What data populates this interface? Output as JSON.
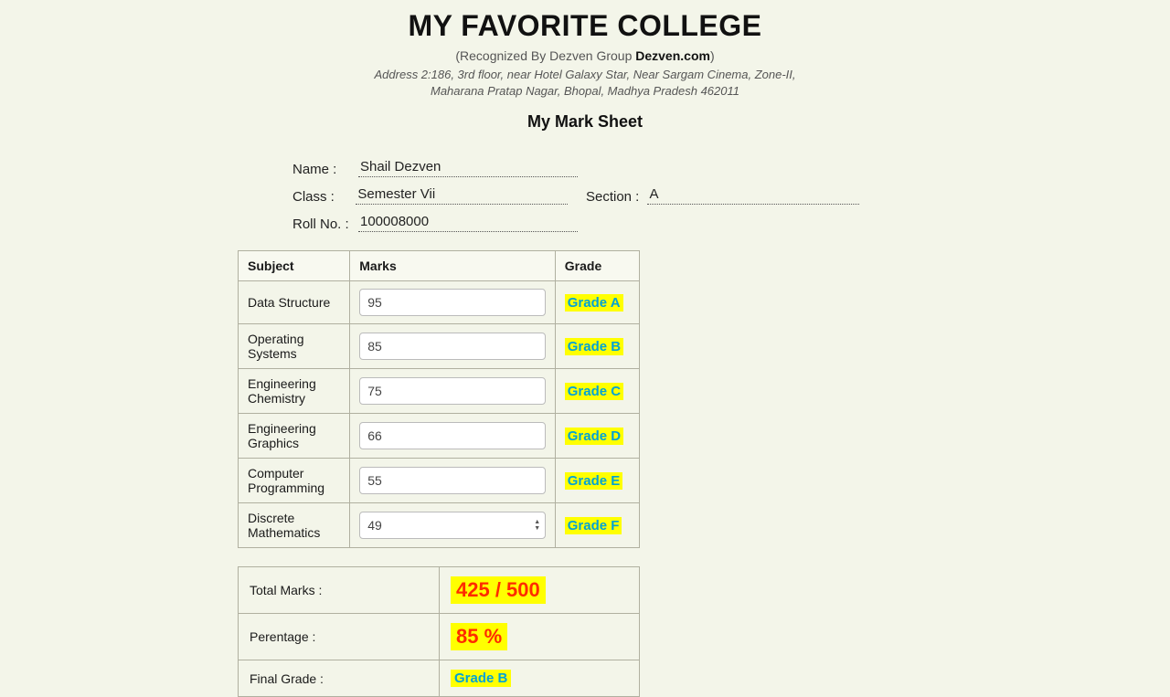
{
  "header": {
    "title": "MY FAVORITE COLLEGE",
    "recognized_pre": "(Recognized By Dezven Group ",
    "recognized_bold": "Dezven.com",
    "recognized_post": ")",
    "address_line1": "Address 2:186, 3rd floor, near Hotel Galaxy Star, Near Sargam Cinema, Zone-II,",
    "address_line2": "Maharana Pratap Nagar, Bhopal, Madhya Pradesh 462011",
    "subtitle": "My Mark Sheet"
  },
  "info": {
    "name_label": "Name :",
    "name_value": "Shail Dezven",
    "class_label": "Class :",
    "class_value": "Semester Vii",
    "section_label": "Section :",
    "section_value": "A",
    "roll_label": "Roll No. :",
    "roll_value": "100008000"
  },
  "table": {
    "headers": {
      "subject": "Subject",
      "marks": "Marks",
      "grade": "Grade"
    },
    "rows": [
      {
        "subject": "Data Structure",
        "marks": "95",
        "grade": "Grade A"
      },
      {
        "subject": "Operating Systems",
        "marks": "85",
        "grade": "Grade B"
      },
      {
        "subject": "Engineering Chemistry",
        "marks": "75",
        "grade": "Grade C"
      },
      {
        "subject": "Engineering Graphics",
        "marks": "66",
        "grade": "Grade D"
      },
      {
        "subject": "Computer Programming",
        "marks": "55",
        "grade": "Grade E"
      },
      {
        "subject": "Discrete Mathematics",
        "marks": "49",
        "grade": "Grade F"
      }
    ]
  },
  "summary": {
    "total_label": "Total Marks :",
    "total_value": "425 / 500",
    "percent_label": "Perentage :",
    "percent_value": "85 %",
    "final_label": "Final Grade :",
    "final_value": "Grade B"
  }
}
